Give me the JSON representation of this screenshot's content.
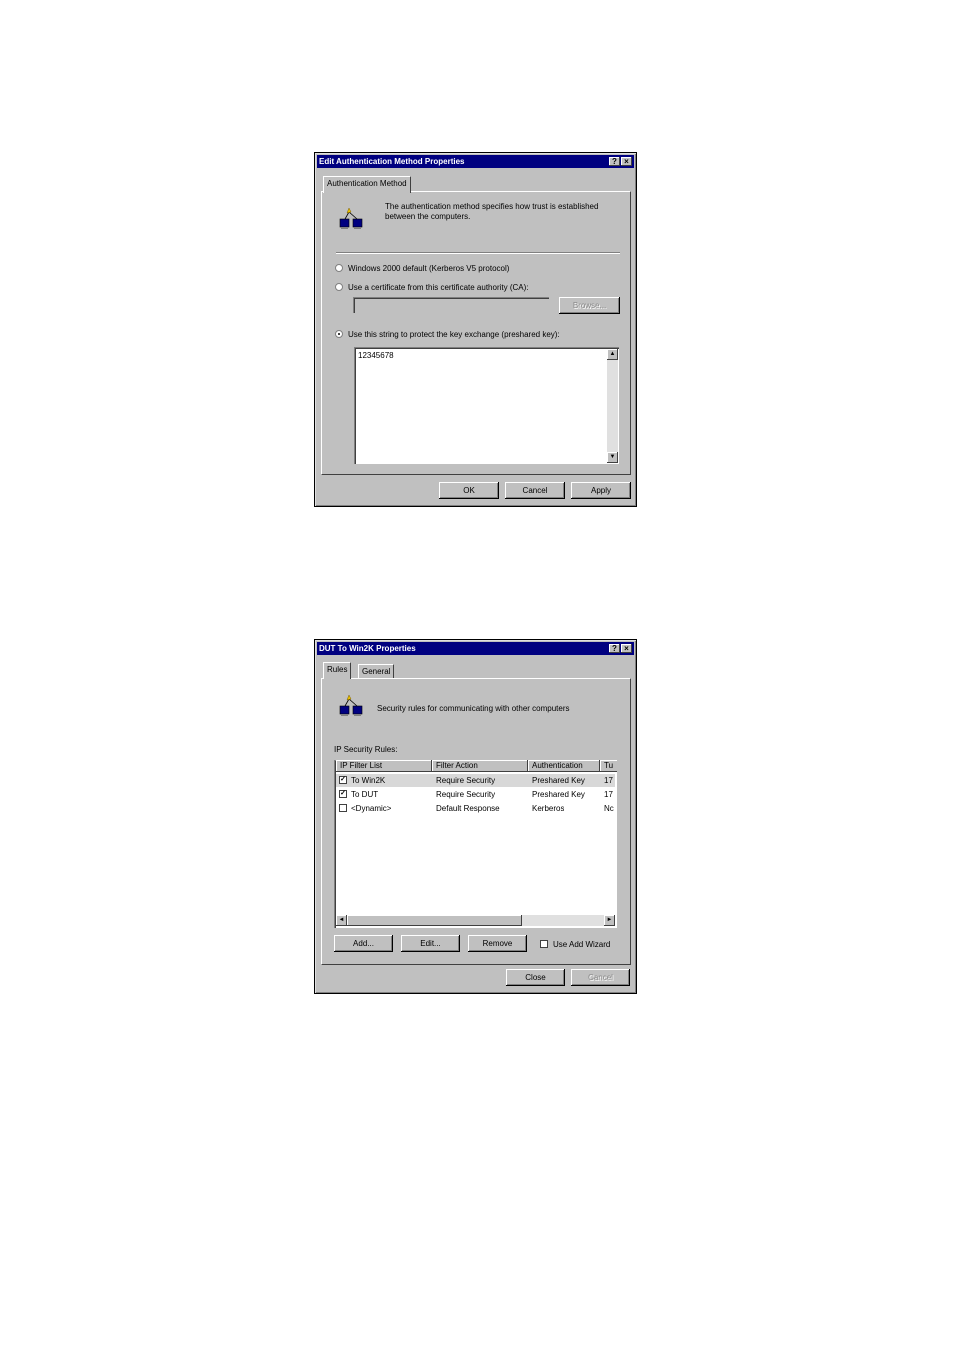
{
  "dialog1": {
    "title": "Edit Authentication Method Properties",
    "help_glyph": "?",
    "close_glyph": "×",
    "tab": "Authentication Method",
    "description": "The authentication method specifies how trust is established between the computers.",
    "options": [
      {
        "label": "Windows 2000 default (Kerberos V5 protocol)",
        "selected": false
      },
      {
        "label": "Use a certificate from this certificate authority (CA):",
        "selected": false
      },
      {
        "label": "Use this string to protect the key exchange (preshared key):",
        "selected": true
      }
    ],
    "ca_field_value": "",
    "browse_label": "Browse...",
    "preshared_key": "12345678",
    "buttons": {
      "ok": "OK",
      "cancel": "Cancel",
      "apply": "Apply"
    }
  },
  "dialog2": {
    "title": "DUT To Win2K Properties",
    "help_glyph": "?",
    "close_glyph": "×",
    "tabs": [
      "Rules",
      "General"
    ],
    "description": "Security rules for communicating with other computers",
    "rules_label": "IP Security Rules:",
    "columns": [
      "IP Filter List",
      "Filter Action",
      "Authentication",
      "Tu"
    ],
    "rows": [
      {
        "checked": true,
        "filter": "To Win2K",
        "action": "Require Security",
        "auth": "Preshared Key",
        "tu": "17"
      },
      {
        "checked": true,
        "filter": "To DUT",
        "action": "Require Security",
        "auth": "Preshared Key",
        "tu": "17"
      },
      {
        "checked": false,
        "filter": "<Dynamic>",
        "action": "Default Response",
        "auth": "Kerberos",
        "tu": "Nc"
      }
    ],
    "buttons": {
      "add": "Add...",
      "edit": "Edit...",
      "remove": "Remove",
      "close": "Close",
      "cancel": "Cancel"
    },
    "wizard_label": "Use Add Wizard",
    "wizard_checked": false,
    "check_glyph": "✓",
    "scroll_left": "◄",
    "scroll_right": "►",
    "scroll_up": "▲",
    "scroll_down": "▼"
  }
}
